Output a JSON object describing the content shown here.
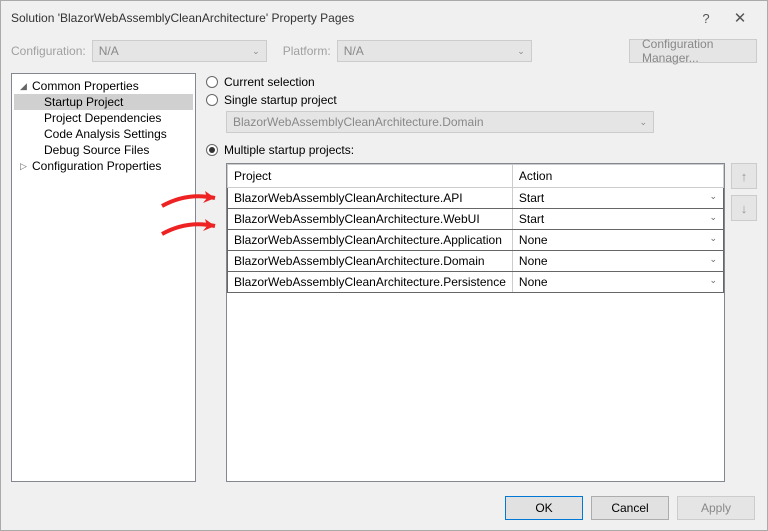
{
  "window": {
    "title": "Solution 'BlazorWebAssemblyCleanArchitecture' Property Pages"
  },
  "configRow": {
    "configLabel": "Configuration:",
    "configValue": "N/A",
    "platformLabel": "Platform:",
    "platformValue": "N/A",
    "cmButton": "Configuration Manager..."
  },
  "tree": {
    "common": "Common Properties",
    "startup": "Startup Project",
    "deps": "Project Dependencies",
    "analysis": "Code Analysis Settings",
    "debug": "Debug Source Files",
    "configProps": "Configuration Properties"
  },
  "radios": {
    "current": "Current selection",
    "single": "Single startup project",
    "singleValue": "BlazorWebAssemblyCleanArchitecture.Domain",
    "multiple": "Multiple startup projects:"
  },
  "table": {
    "hProject": "Project",
    "hAction": "Action",
    "rows": [
      {
        "project": "BlazorWebAssemblyCleanArchitecture.API",
        "action": "Start"
      },
      {
        "project": "BlazorWebAssemblyCleanArchitecture.WebUI",
        "action": "Start"
      },
      {
        "project": "BlazorWebAssemblyCleanArchitecture.Application",
        "action": "None"
      },
      {
        "project": "BlazorWebAssemblyCleanArchitecture.Domain",
        "action": "None"
      },
      {
        "project": "BlazorWebAssemblyCleanArchitecture.Persistence",
        "action": "None"
      }
    ]
  },
  "footer": {
    "ok": "OK",
    "cancel": "Cancel",
    "apply": "Apply"
  },
  "icons": {
    "up": "↑",
    "down": "↓",
    "help": "?",
    "close": "✕",
    "caret": "⌄"
  }
}
